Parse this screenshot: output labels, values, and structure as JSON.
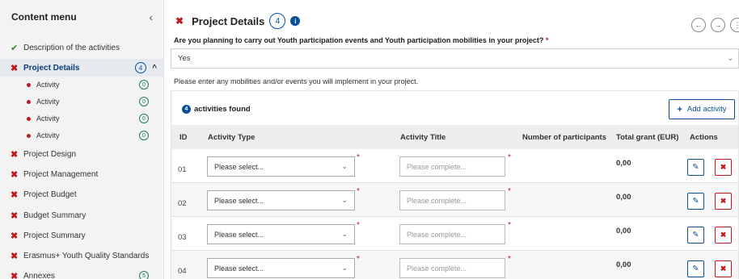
{
  "sidebar": {
    "title": "Content menu",
    "collapse_icon": "chevron-left-icon",
    "items": [
      {
        "label": "Description of the activities",
        "status": "complete"
      },
      {
        "label": "Project Details",
        "status": "incomplete",
        "badge": "4",
        "active": true
      },
      {
        "label": "Project Design",
        "status": "incomplete"
      },
      {
        "label": "Project Management",
        "status": "incomplete"
      },
      {
        "label": "Project Budget",
        "status": "incomplete"
      },
      {
        "label": "Budget Summary",
        "status": "incomplete"
      },
      {
        "label": "Project Summary",
        "status": "incomplete"
      },
      {
        "label": "Erasmus+ Youth Quality Standards",
        "status": "incomplete"
      },
      {
        "label": "Annexes",
        "status": "incomplete",
        "badge": "5"
      }
    ],
    "subitems": [
      {
        "label": "Activity",
        "badge": "0"
      },
      {
        "label": "Activity",
        "badge": "0"
      },
      {
        "label": "Activity",
        "badge": "0"
      },
      {
        "label": "Activity",
        "badge": "0"
      }
    ]
  },
  "main": {
    "title": "Project Details",
    "count": "4",
    "info_icon": "info-icon",
    "question": "Are you planning to carry out Youth participation events and Youth participation mobilities in your project?",
    "required_mark": "*",
    "answer": "Yes",
    "hint": "Please enter any mobilities and/or events you will implement in your project.",
    "found_count": "4",
    "found_label": "activities found",
    "add_label": "Add activity",
    "columns": {
      "id": "ID",
      "type": "Activity Type",
      "title": "Activity Title",
      "participants": "Number of participants",
      "grant": "Total grant (EUR)",
      "actions": "Actions"
    },
    "rows": [
      {
        "id": "01",
        "type": "Please select...",
        "title_placeholder": "Please complete...",
        "grant": "0,00"
      },
      {
        "id": "02",
        "type": "Please select...",
        "title_placeholder": "Please complete...",
        "grant": "0,00"
      },
      {
        "id": "03",
        "type": "Please select...",
        "title_placeholder": "Please complete...",
        "grant": "0,00"
      },
      {
        "id": "04",
        "type": "Please select...",
        "title_placeholder": "Please complete...",
        "grant": "0,00"
      }
    ]
  },
  "colors": {
    "primary": "#0b4f9c",
    "error": "#c01a1a",
    "success": "#3a8a2f"
  }
}
